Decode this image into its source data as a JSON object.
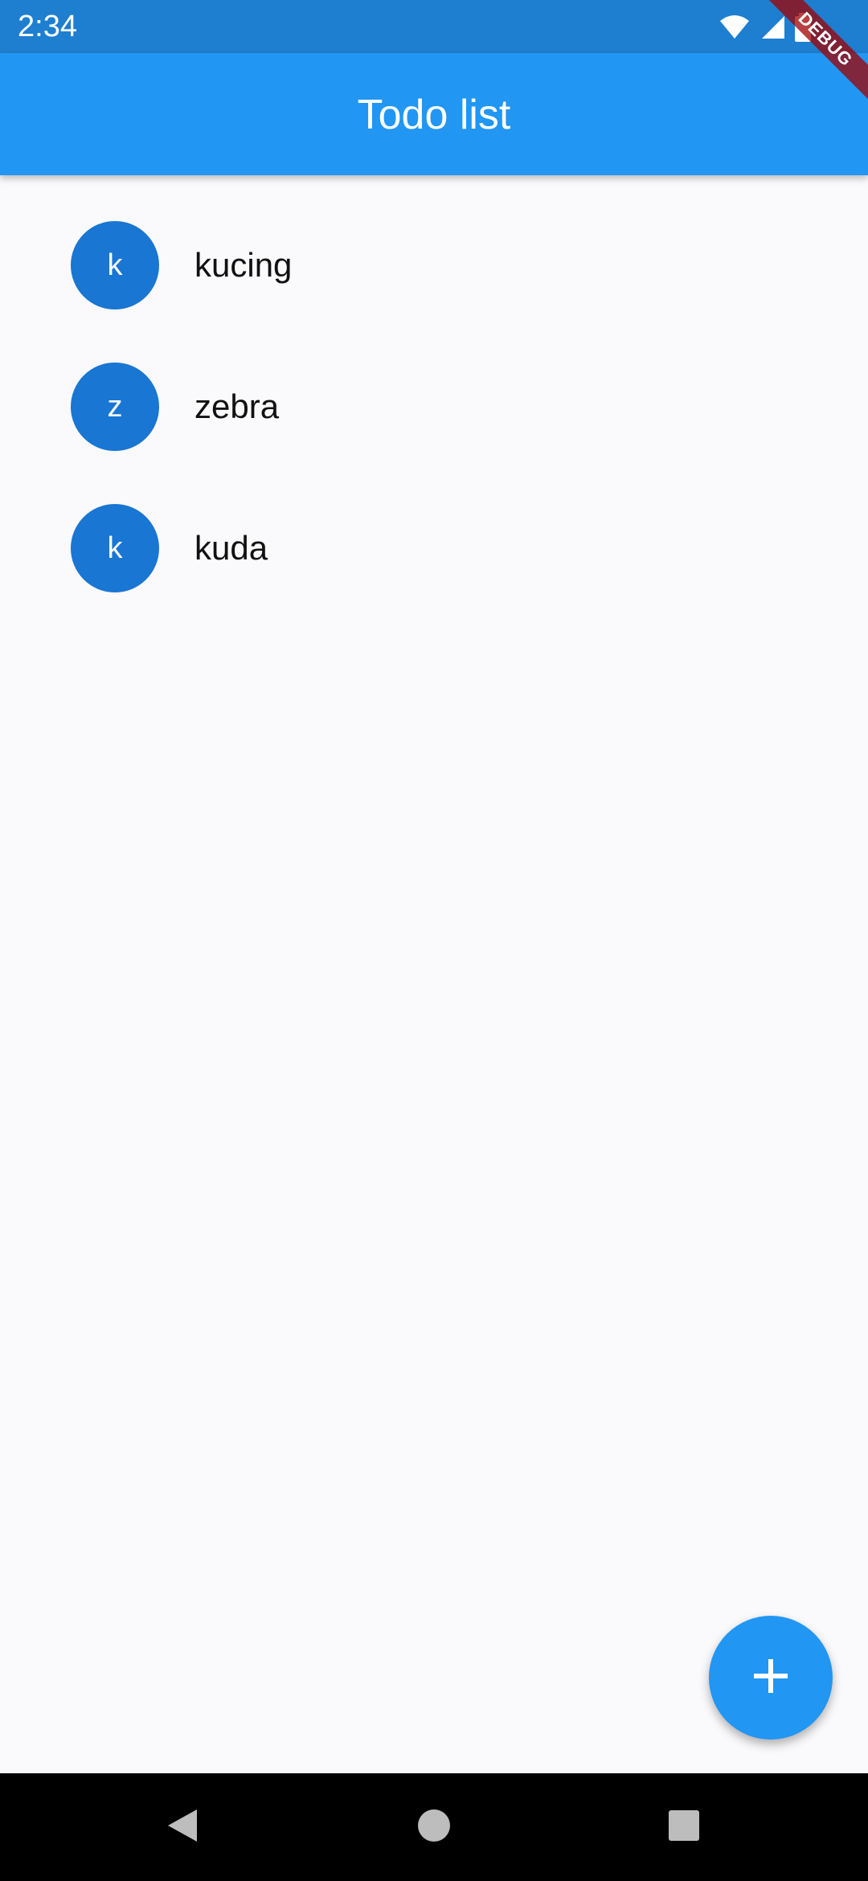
{
  "status_bar": {
    "time": "2:34"
  },
  "app_bar": {
    "title": "Todo list"
  },
  "debug_banner": {
    "label": "DEBUG"
  },
  "todos": [
    {
      "initial": "k",
      "label": "kucing"
    },
    {
      "initial": "z",
      "label": "zebra"
    },
    {
      "initial": "k",
      "label": "kuda"
    }
  ],
  "fab": {
    "icon": "add-icon"
  },
  "nav_bar": {
    "icons": [
      "back-icon",
      "home-icon",
      "recents-icon"
    ]
  },
  "colors": {
    "app_bar": "#2196f3",
    "status_bar": "#1e7fd0",
    "avatar": "#1976d2",
    "fab": "#2196f3",
    "background": "#faf9fb"
  }
}
